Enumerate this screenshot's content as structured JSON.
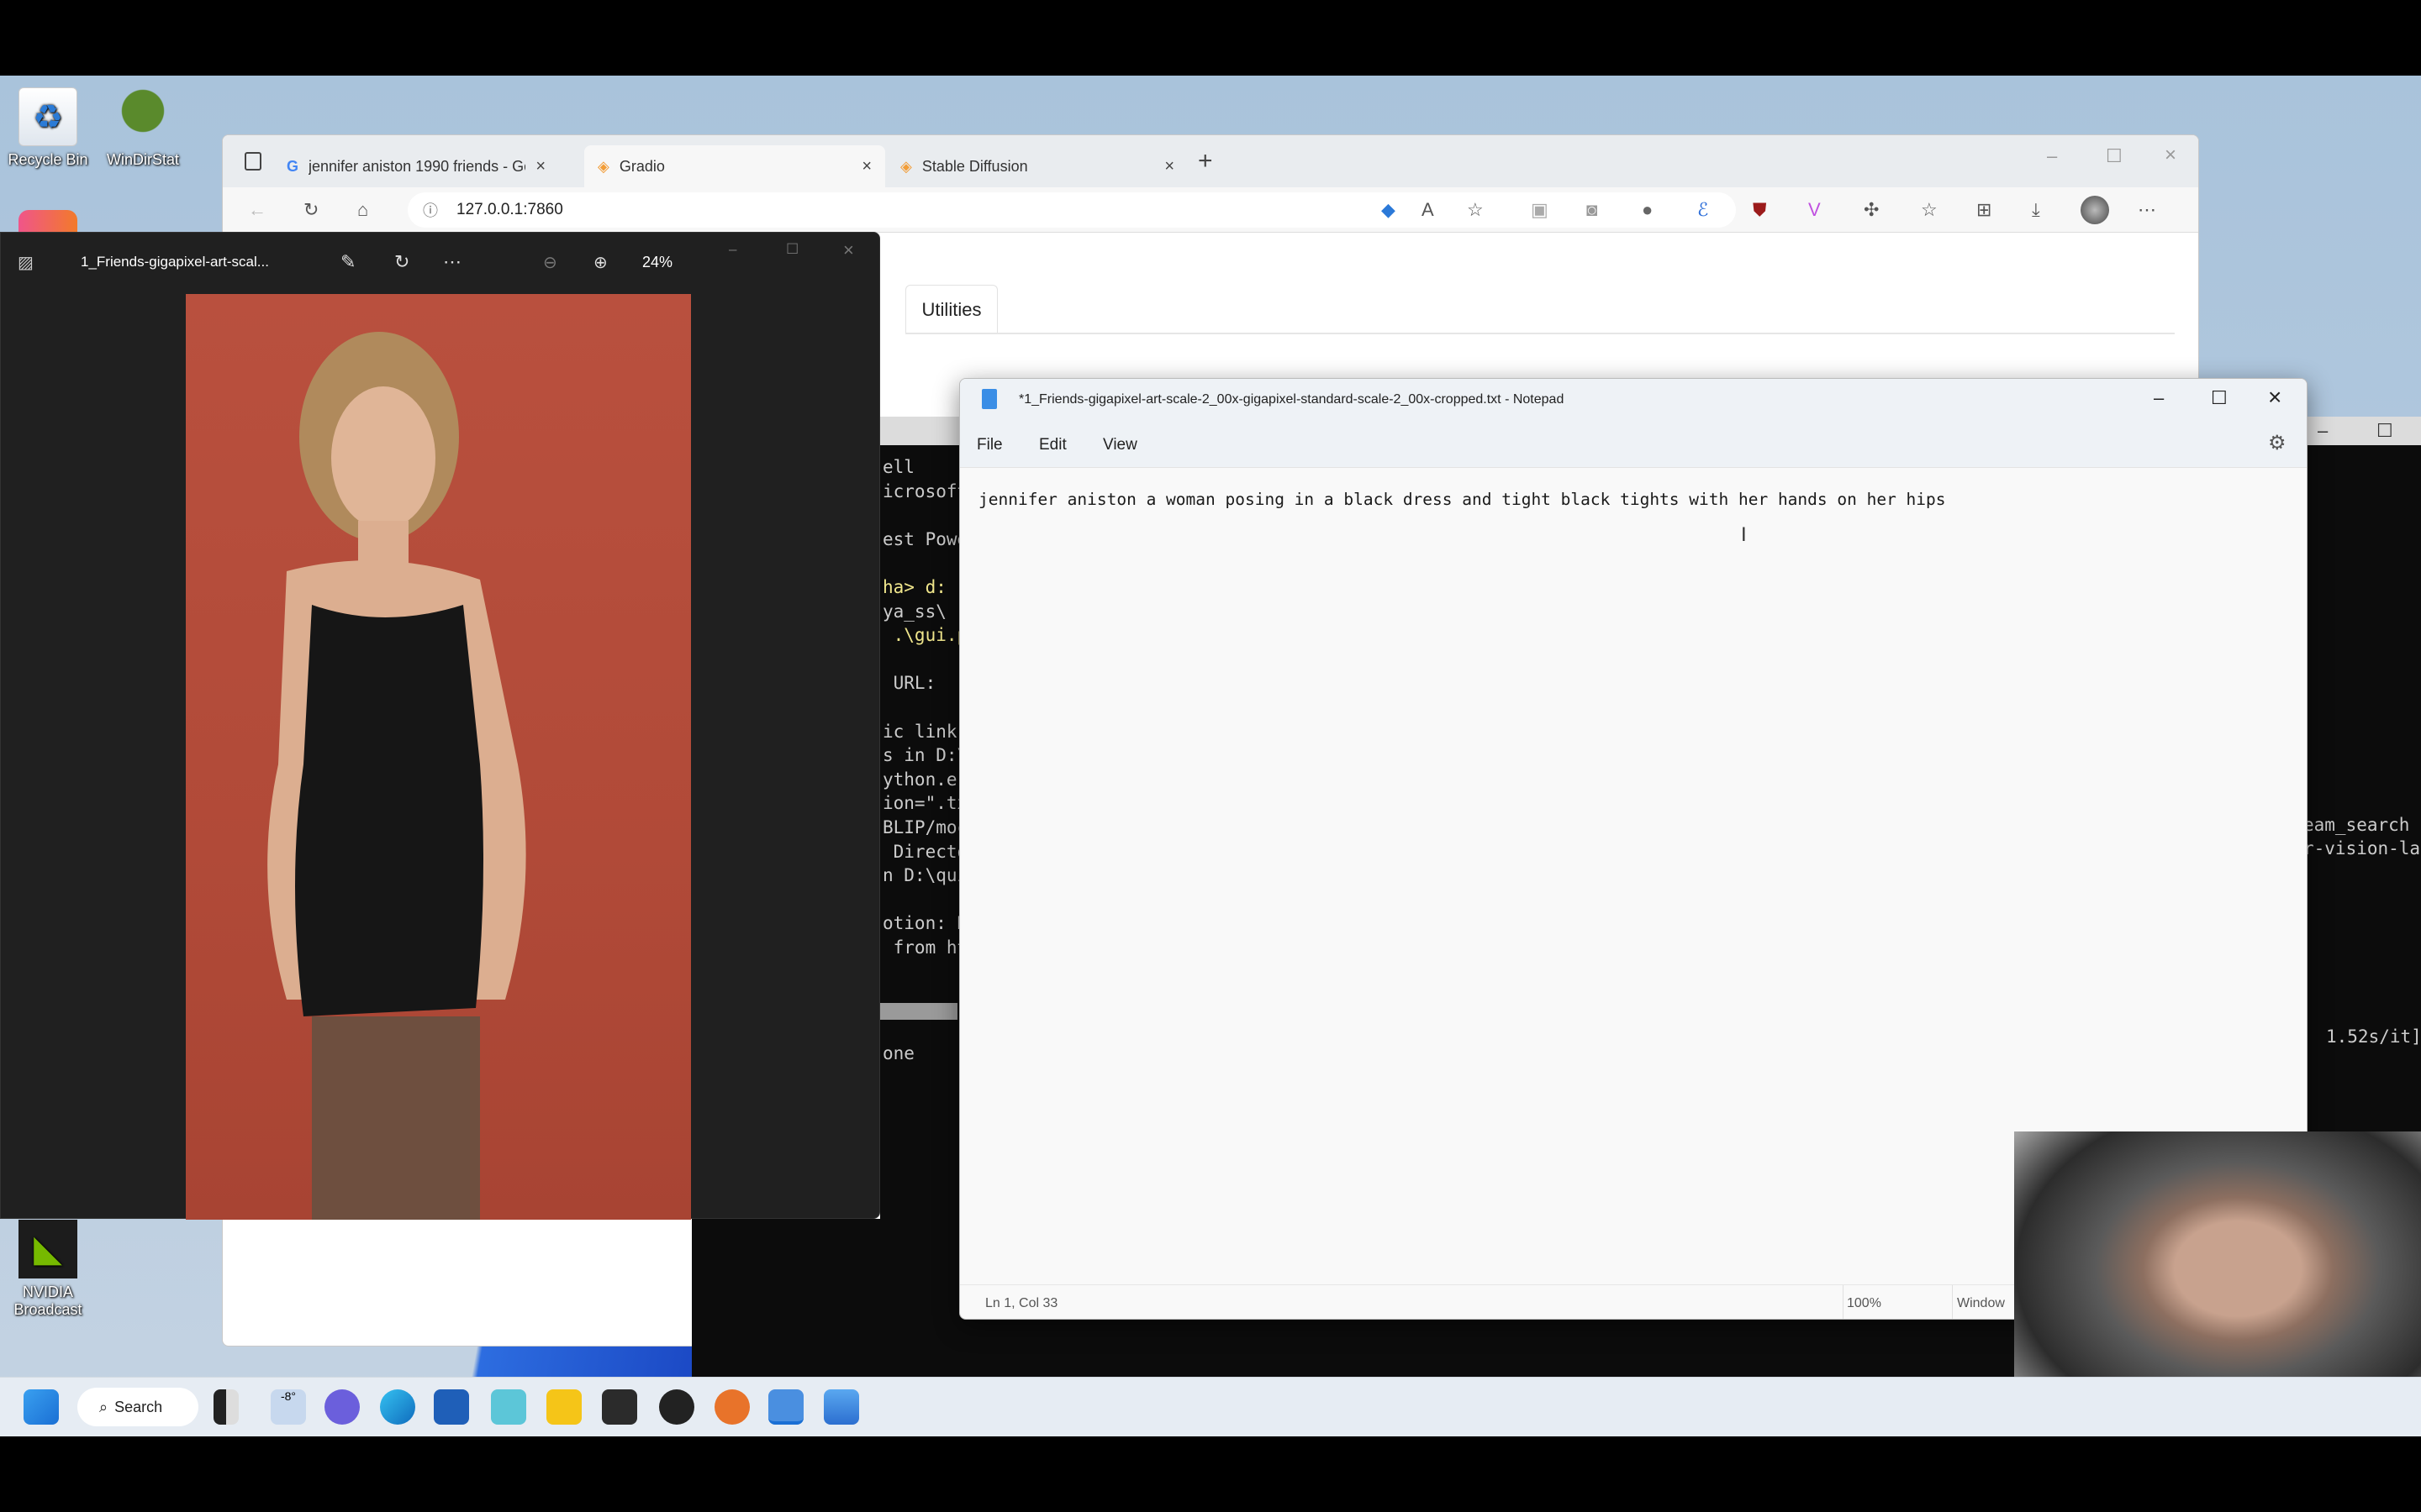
{
  "desktop": {
    "icons": [
      {
        "label": "Recycle Bin",
        "icon": "recycle-bin-icon"
      },
      {
        "label": "WinDirStat",
        "icon": "windirstat-icon"
      },
      {
        "label": "NVIDIA Broadcast",
        "icon": "nvidia-broadcast-icon"
      }
    ]
  },
  "browser": {
    "tabs": [
      {
        "label": "jennifer aniston 1990 friends - Go",
        "icon": "google-icon"
      },
      {
        "label": "Gradio",
        "icon": "gradio-icon",
        "active": true
      },
      {
        "label": "Stable Diffusion",
        "icon": "gradio-icon"
      }
    ],
    "url": "127.0.0.1:7860",
    "content": {
      "tab_label": "Utilities"
    }
  },
  "photos": {
    "title": "1_Friends-gigapixel-art-scal...",
    "zoom": "24%"
  },
  "terminal": {
    "left_lines": [
      "ell",
      "icrosoft",
      "",
      "est Powe",
      "",
      "ha> d:",
      "ya_ss\\",
      " .\\gui.p",
      "",
      " URL:",
      "",
      "ic link",
      "s in D:\\",
      "ython.e",
      "ion=\".tx",
      "BLIP/moc",
      " Directo",
      "n D:\\qui",
      "",
      "otion: H",
      " from ht"
    ],
    "bottom_line": "one",
    "right_lines": [
      "eam_search",
      "r-vision-la"
    ],
    "progress": "1.52s/it]"
  },
  "notepad": {
    "title": "*1_Friends-gigapixel-art-scale-2_00x-gigapixel-standard-scale-2_00x-cropped.txt - Notepad",
    "menu": [
      "File",
      "Edit",
      "View"
    ],
    "text": "jennifer aniston a woman posing in a black dress and tight black tights with her hands on her hips",
    "status": {
      "position": "Ln 1, Col 33",
      "zoom": "100%",
      "line_ending": "Window"
    }
  },
  "taskbar": {
    "search_label": "Search",
    "weather": "-8°"
  }
}
